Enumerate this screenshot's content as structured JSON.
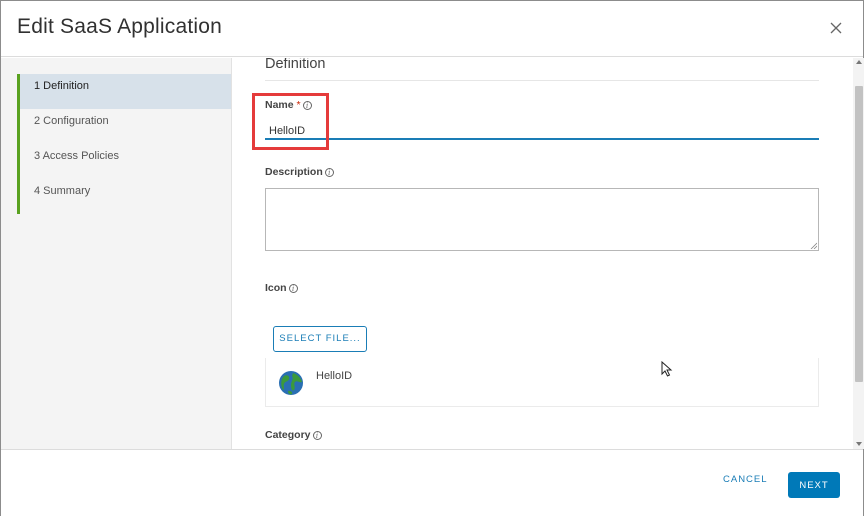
{
  "dialog": {
    "title": "Edit SaaS Application"
  },
  "steps": [
    {
      "label": "1 Definition",
      "active": true
    },
    {
      "label": "2 Configuration",
      "active": false
    },
    {
      "label": "3 Access Policies",
      "active": false
    },
    {
      "label": "4 Summary",
      "active": false
    }
  ],
  "form": {
    "section_title": "Definition",
    "name_label": "Name",
    "required_marker": "*",
    "name_value": "HelloID",
    "description_label": "Description",
    "description_value": "",
    "icon_label": "Icon",
    "select_file_label": "SELECT FILE...",
    "file_name": "HelloID",
    "category_label": "Category"
  },
  "footer": {
    "cancel_label": "CANCEL",
    "next_label": "NEXT"
  },
  "colors": {
    "accent": "#0079b8",
    "step_indicator": "#5aa220",
    "highlight": "#e53b3b"
  }
}
